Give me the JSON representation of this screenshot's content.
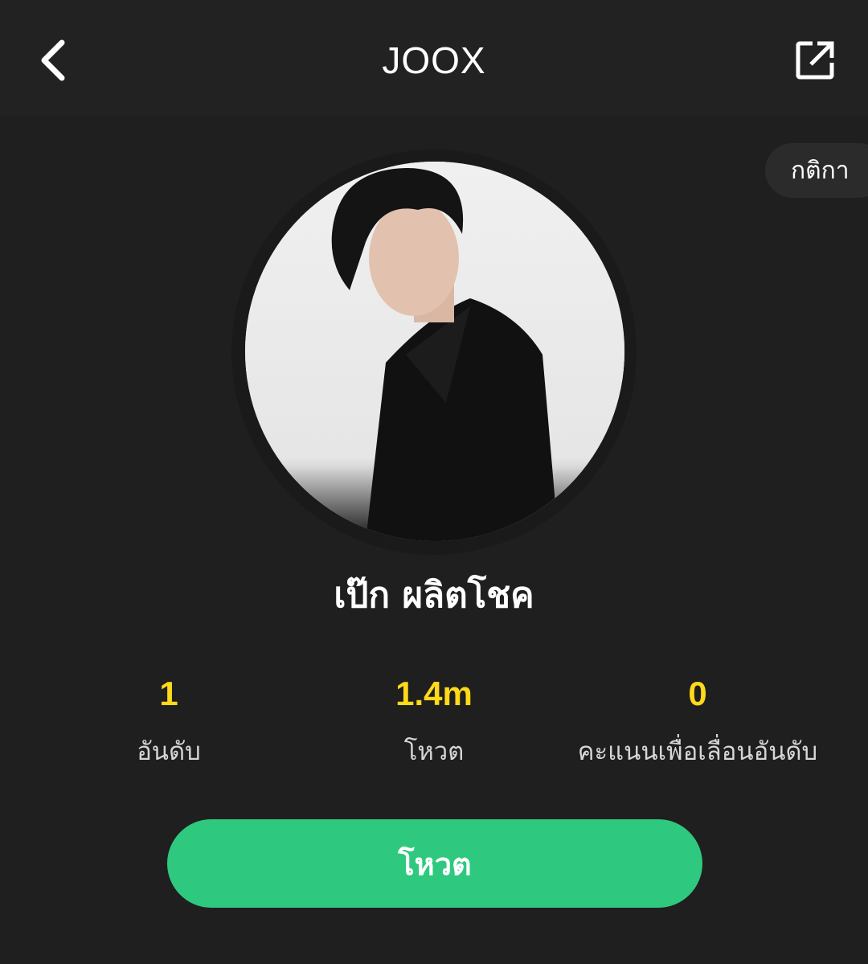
{
  "header": {
    "title": "JOOX",
    "back_icon": "chevron-left-icon",
    "share_icon": "external-link-icon"
  },
  "rules_label": "กติกา",
  "artist": {
    "name": "เป๊ก ผลิตโชค"
  },
  "stats": [
    {
      "value": "1",
      "label": "อันดับ"
    },
    {
      "value": "1.4m",
      "label": "โหวต"
    },
    {
      "value": "0",
      "label": "คะแนนเพื่อเลื่อนอันดับ"
    }
  ],
  "vote_button_label": "โหวต",
  "colors": {
    "background": "#1f1f1f",
    "accent_yellow": "#ffd91a",
    "vote_green": "#2ec97f"
  }
}
